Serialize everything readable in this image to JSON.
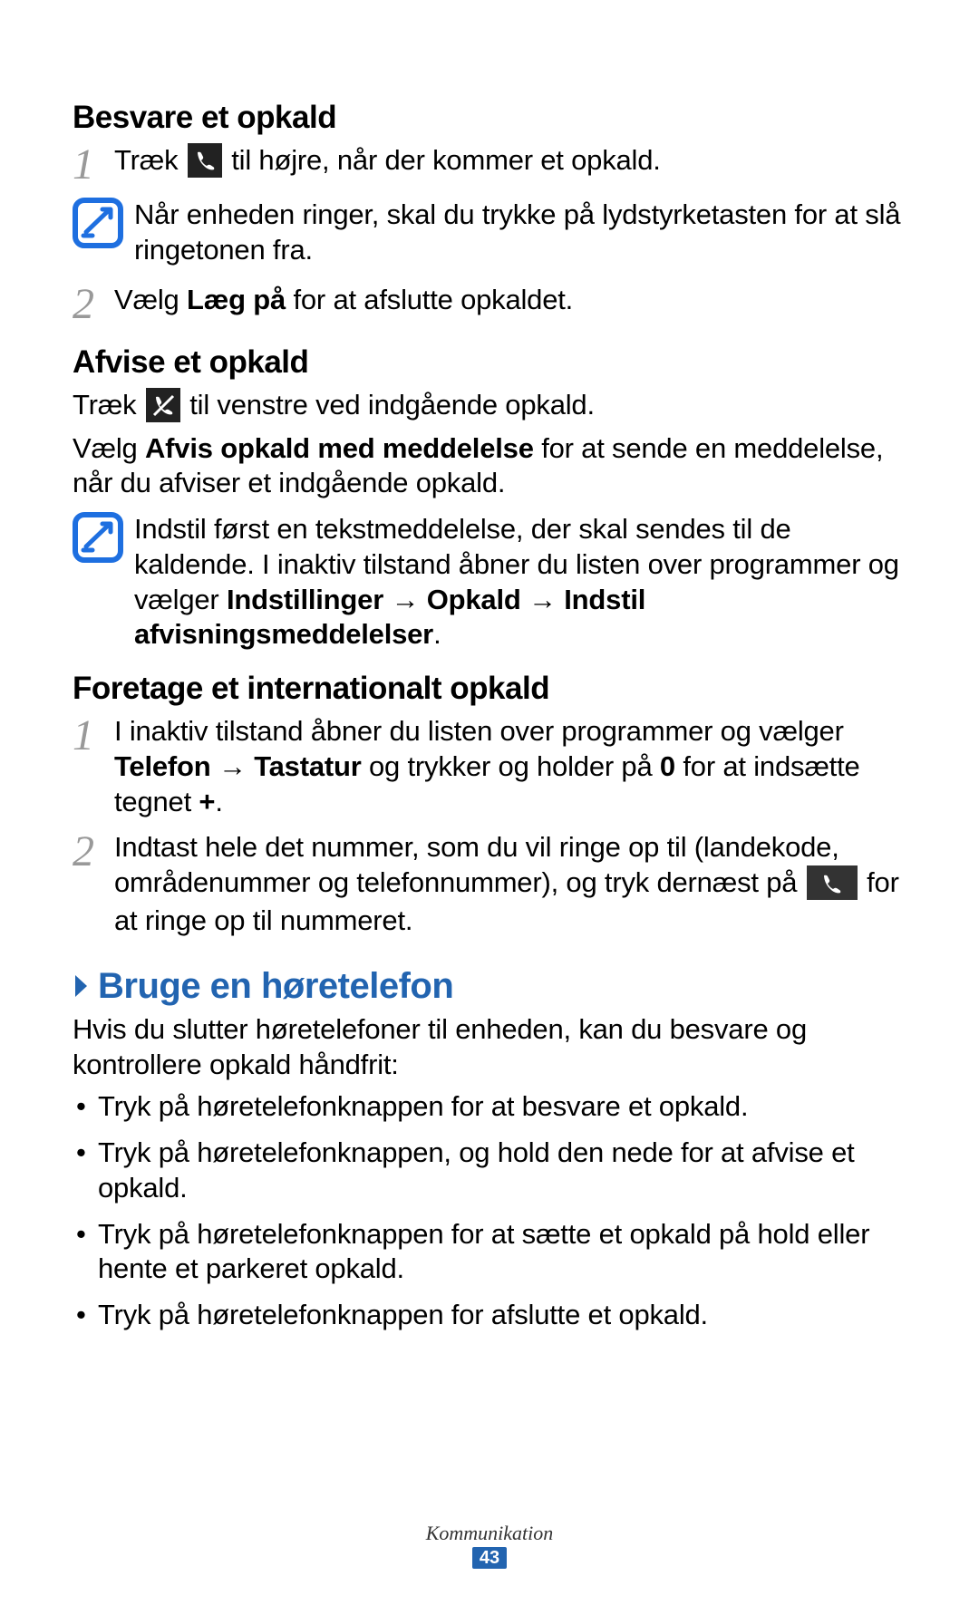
{
  "section1": {
    "title": "Besvare et opkald",
    "step1_a": "Træk",
    "step1_b": "til højre, når der kommer et opkald.",
    "note1": "Når enheden ringer, skal du trykke på lydstyrketasten for at slå ringetonen fra.",
    "step2_a": "Vælg",
    "step2_b": "Læg på",
    "step2_c": "for at afslutte opkaldet."
  },
  "section2": {
    "title": "Afvise et opkald",
    "line1_a": "Træk",
    "line1_b": "til venstre ved indgående opkald.",
    "line2_a": "Vælg",
    "line2_b": "Afvis opkald med meddelelse",
    "line2_c": "for at sende en meddelelse, når du afviser et indgående opkald.",
    "note_a": "Indstil først en tekstmeddelelse, der skal sendes til de kaldende. I inaktiv tilstand åbner du listen over programmer og vælger",
    "note_b": "Indstillinger",
    "note_arrow1": "→",
    "note_c": "Opkald",
    "note_arrow2": "→",
    "note_d": "Indstil afvisningsmeddelelser",
    "note_e": "."
  },
  "section3": {
    "title": "Foretage et internationalt opkald",
    "step1_a": "I inaktiv tilstand åbner du listen over programmer og vælger",
    "step1_b": "Telefon",
    "step1_arrow": "→",
    "step1_c": "Tastatur",
    "step1_d": "og trykker og holder på",
    "step1_e": "0",
    "step1_f": "for at indsætte tegnet",
    "step1_g": "+",
    "step1_h": ".",
    "step2_a": "Indtast hele det nummer, som du vil ringe op til (landekode, områdenummer og telefonnummer), og tryk dernæst på",
    "step2_b": "for at ringe op til nummeret."
  },
  "section4": {
    "title": "Bruge en høretelefon",
    "intro": "Hvis du slutter høretelefoner til enheden, kan du besvare og kontrollere opkald håndfrit:",
    "bullets": [
      "Tryk på høretelefonknappen for at besvare et opkald.",
      "Tryk på høretelefonknappen, og hold den nede for at afvise et opkald.",
      "Tryk på høretelefonknappen for at sætte et opkald på hold eller hente et parkeret opkald.",
      "Tryk på høretelefonknappen for afslutte et opkald."
    ]
  },
  "footer": {
    "section": "Kommunikation",
    "page": "43"
  }
}
